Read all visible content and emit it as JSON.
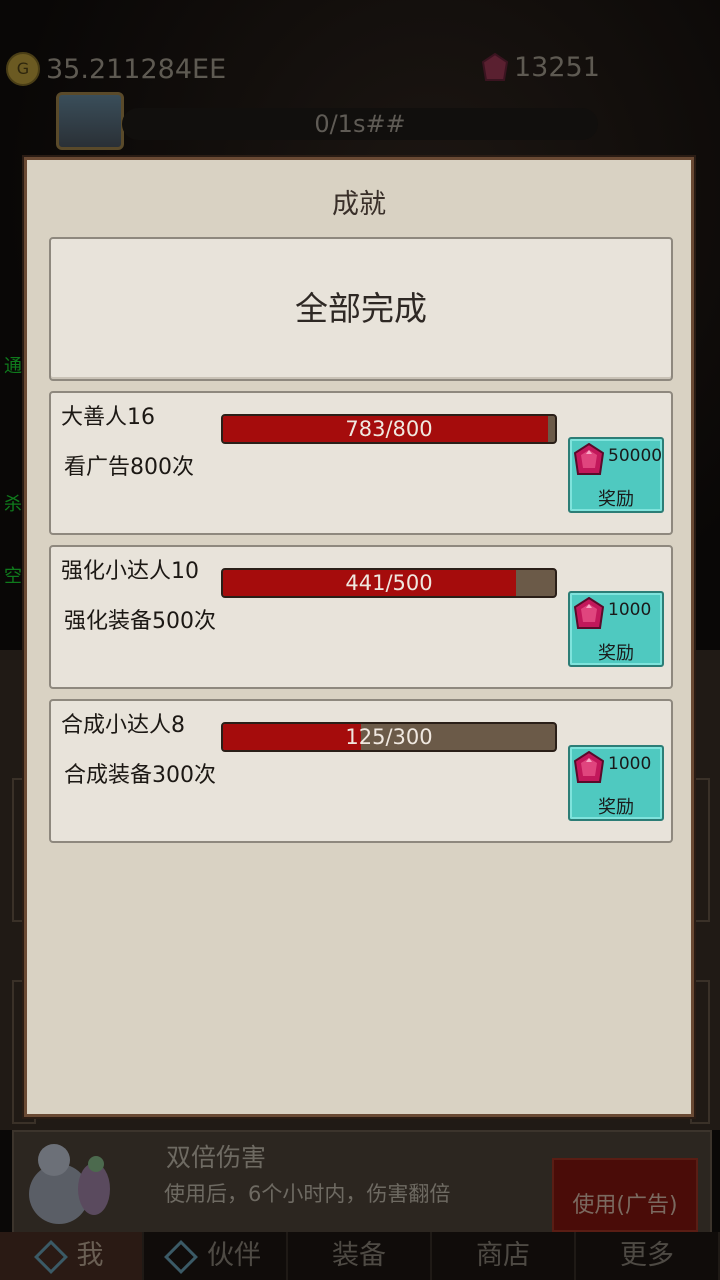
{
  "top_bar": {
    "gold": "35.211284EE",
    "gems": "13251",
    "timer": "0/1s##"
  },
  "side_labels": [
    "通",
    "杀",
    "空"
  ],
  "bottom_buff": {
    "title": "双倍伤害",
    "description": "使用后，6个小时内，伤害翻倍",
    "use_button": "使用(广告)"
  },
  "nav": {
    "items": [
      {
        "label": "我"
      },
      {
        "label": "伙伴"
      },
      {
        "label": "装备"
      },
      {
        "label": "商店"
      },
      {
        "label": "更多"
      }
    ]
  },
  "modal": {
    "title": "成就",
    "complete_all": "全部完成",
    "achievements": [
      {
        "name": "大善人16",
        "description": "看广告800次",
        "progress": "783/800",
        "progress_fraction": 0.979,
        "reward_amount": "50000",
        "reward_label": "奖励"
      },
      {
        "name": "强化小达人10",
        "description": "强化装备500次",
        "progress": "441/500",
        "progress_fraction": 0.882,
        "reward_amount": "1000",
        "reward_label": "奖励"
      },
      {
        "name": "合成小达人8",
        "description": "合成装备300次",
        "progress": "125/300",
        "progress_fraction": 0.417,
        "reward_amount": "1000",
        "reward_label": "奖励"
      }
    ]
  },
  "colors": {
    "progress_fill": "#a50c0c",
    "progress_track": "#6b5a48",
    "reward_button": "#4fc9c0",
    "modal_bg": "#d9d2c3",
    "gem": "#c2185b"
  },
  "icons": {
    "gold": "gold-coin-icon",
    "gem": "ruby-gem-icon",
    "chest": "treasure-chest-icon",
    "nav": "diamond-nav-icon"
  }
}
